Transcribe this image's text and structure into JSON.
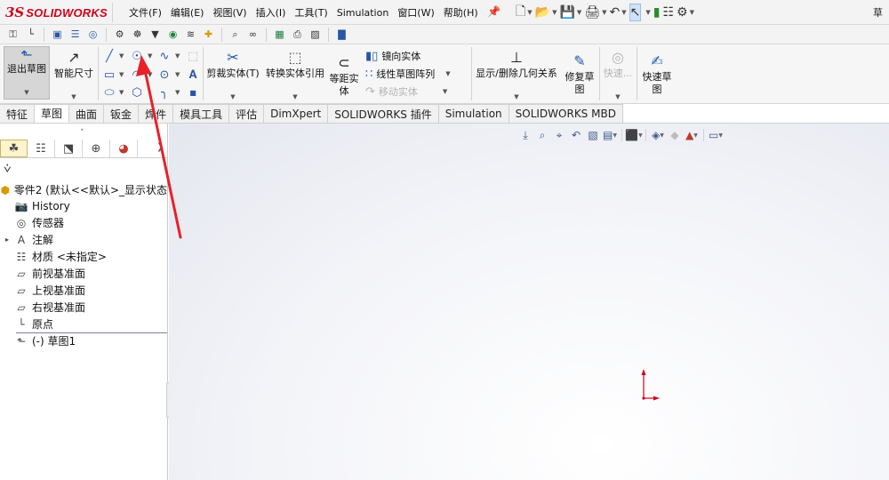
{
  "app": {
    "logo_ds": "3S",
    "logo_text": "SOLIDWORKS",
    "title_right": "草"
  },
  "menu": [
    "文件(F)",
    "编辑(E)",
    "视图(V)",
    "插入(I)",
    "工具(T)",
    "Simulation",
    "窗口(W)",
    "帮助(H)"
  ],
  "command_manager": {
    "exit_sketch": "退出草图",
    "smart_dimension": "智能尺寸",
    "trim_entities": "剪裁实体(T)",
    "convert_entities": "转换实体引用",
    "offset_entities": "等距实\n体",
    "mirror_entities": "镜向实体",
    "linear_pattern": "线性草图阵列",
    "move_entities": "移动实体",
    "display_relations": "显示/删除几何关系",
    "repair_sketch": "修复草\n图",
    "quick_snaps": "快速...",
    "rapid_sketch": "快速草\n图"
  },
  "tabs": [
    {
      "label": "特征",
      "active": false
    },
    {
      "label": "草图",
      "active": true
    },
    {
      "label": "曲面",
      "active": false
    },
    {
      "label": "钣金",
      "active": false
    },
    {
      "label": "焊件",
      "active": false
    },
    {
      "label": "模具工具",
      "active": false
    },
    {
      "label": "评估",
      "active": false
    },
    {
      "label": "DimXpert",
      "active": false
    },
    {
      "label": "SOLIDWORKS 插件",
      "active": false
    },
    {
      "label": "Simulation",
      "active": false
    },
    {
      "label": "SOLIDWORKS MBD",
      "active": false
    }
  ],
  "tree": {
    "root": "零件2 (默认<<默认>_显示状态",
    "items": [
      {
        "label": "History",
        "icon": "history-icon"
      },
      {
        "label": "传感器",
        "icon": "sensor-icon"
      },
      {
        "label": "注解",
        "icon": "annotation-icon"
      },
      {
        "label": "材质 <未指定>",
        "icon": "material-icon"
      },
      {
        "label": "前视基准面",
        "icon": "plane-icon"
      },
      {
        "label": "上视基准面",
        "icon": "plane-icon"
      },
      {
        "label": "右视基准面",
        "icon": "plane-icon"
      },
      {
        "label": "原点",
        "icon": "origin-icon"
      },
      {
        "label": "(-) 草图1",
        "icon": "sketch-icon"
      }
    ]
  },
  "colors": {
    "brand_red": "#d0021b",
    "annotation_red": "#e8202a",
    "active_tab": "#ffffff",
    "selected_feature_tab": "#fff4cc"
  }
}
